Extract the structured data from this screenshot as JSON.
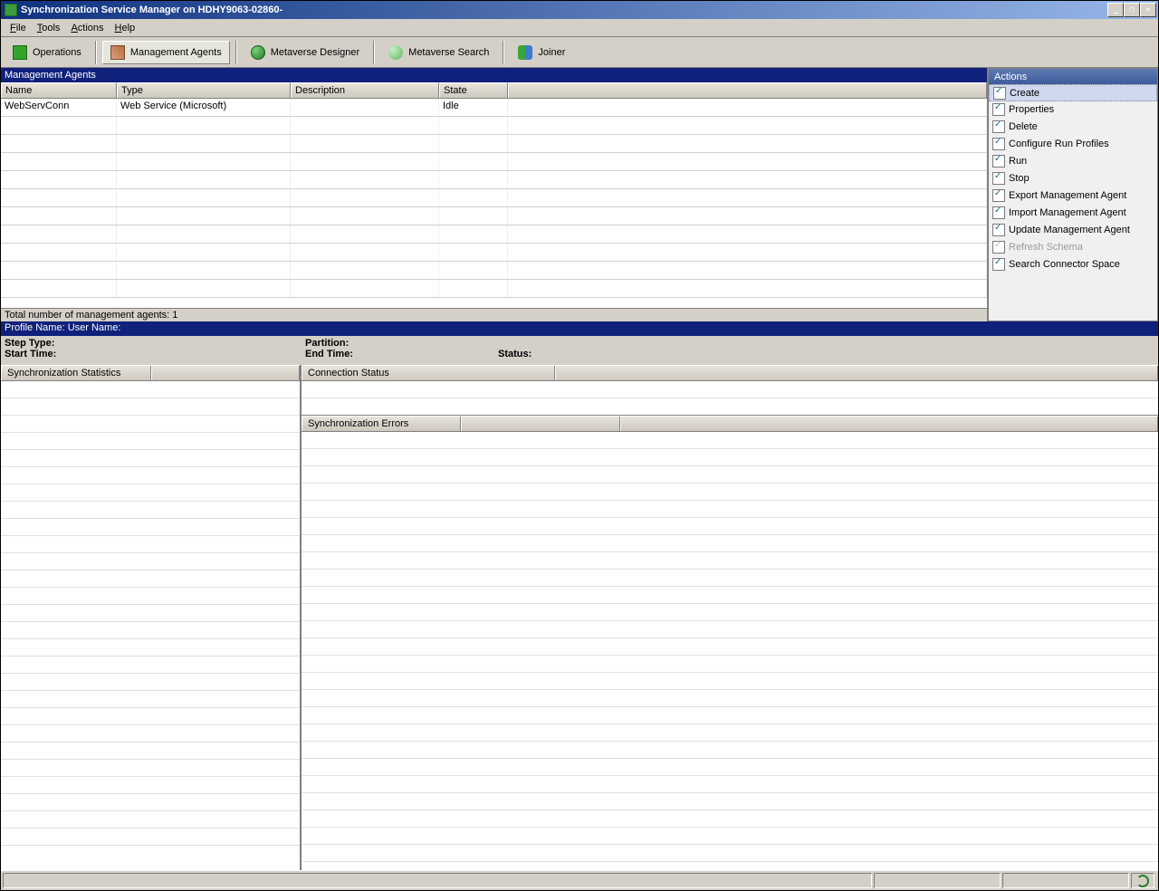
{
  "titlebar": {
    "text": "Synchronization Service Manager on HDHY9063-02860-"
  },
  "menu": {
    "file": "File",
    "tools": "Tools",
    "actions": "Actions",
    "help": "Help"
  },
  "toolbar": {
    "operations": "Operations",
    "agents": "Management Agents",
    "designer": "Metaverse Designer",
    "search": "Metaverse Search",
    "joiner": "Joiner"
  },
  "sections": {
    "management_agents": "Management Agents",
    "actions": "Actions"
  },
  "grid": {
    "headers": {
      "name": "Name",
      "type": "Type",
      "description": "Description",
      "state": "State"
    },
    "rows": [
      {
        "name": "WebServConn",
        "type": "Web Service (Microsoft)",
        "description": "",
        "state": "Idle"
      }
    ]
  },
  "total": "Total number of management agents: 1",
  "profile_bar": "Profile Name:   User Name:",
  "info": {
    "step_type": "Step Type:",
    "start_time": "Start Time:",
    "partition": "Partition:",
    "end_time": "End Time:",
    "status": "Status:"
  },
  "sync_stats_header": "Synchronization Statistics",
  "conn_status_header": "Connection Status",
  "sync_errors_header": "Synchronization Errors",
  "actions": {
    "create": "Create",
    "properties": "Properties",
    "delete": "Delete",
    "configure_run_profiles": "Configure Run Profiles",
    "run": "Run",
    "stop": "Stop",
    "export_ma": "Export Management Agent",
    "import_ma": "Import Management Agent",
    "update_ma": "Update Management Agent",
    "refresh_schema": "Refresh Schema",
    "search_cs": "Search Connector Space"
  }
}
